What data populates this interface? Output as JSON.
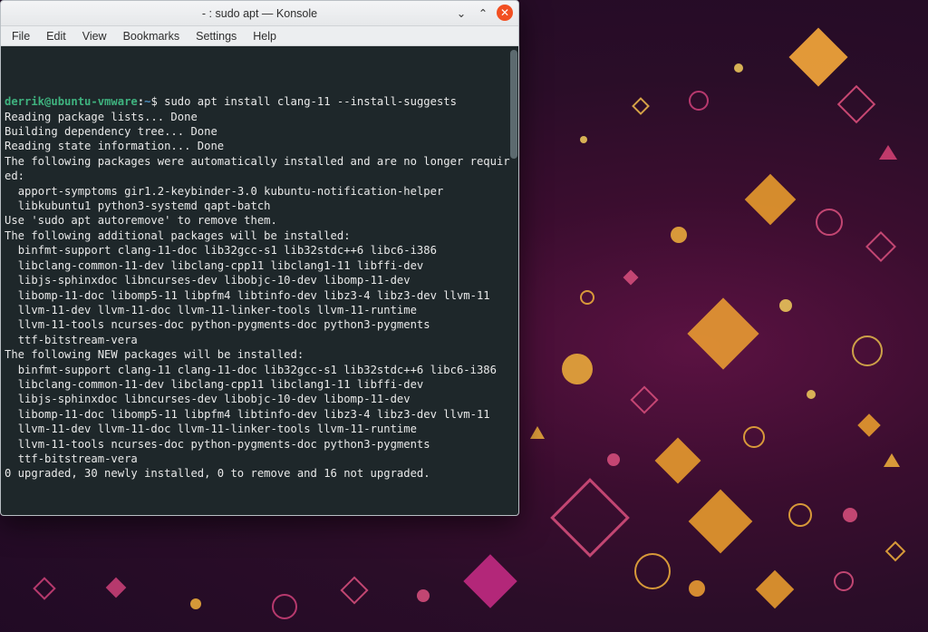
{
  "window": {
    "title": "- : sudo apt — Konsole"
  },
  "menubar": {
    "items": [
      "File",
      "Edit",
      "View",
      "Bookmarks",
      "Settings",
      "Help"
    ]
  },
  "prompt": {
    "user_host": "derrik@ubuntu-vmware",
    "separator": ":",
    "path": "~",
    "symbol": "$",
    "command": "sudo apt install clang-11 --install-suggests"
  },
  "terminal_lines": [
    "Reading package lists... Done",
    "Building dependency tree... Done",
    "Reading state information... Done",
    "The following packages were automatically installed and are no longer requir",
    "ed:",
    "  apport-symptoms gir1.2-keybinder-3.0 kubuntu-notification-helper",
    "  libkubuntu1 python3-systemd qapt-batch",
    "Use 'sudo apt autoremove' to remove them.",
    "The following additional packages will be installed:",
    "  binfmt-support clang-11-doc lib32gcc-s1 lib32stdc++6 libc6-i386",
    "  libclang-common-11-dev libclang-cpp11 libclang1-11 libffi-dev",
    "  libjs-sphinxdoc libncurses-dev libobjc-10-dev libomp-11-dev",
    "  libomp-11-doc libomp5-11 libpfm4 libtinfo-dev libz3-4 libz3-dev llvm-11",
    "  llvm-11-dev llvm-11-doc llvm-11-linker-tools llvm-11-runtime",
    "  llvm-11-tools ncurses-doc python-pygments-doc python3-pygments",
    "  ttf-bitstream-vera",
    "The following NEW packages will be installed:",
    "  binfmt-support clang-11 clang-11-doc lib32gcc-s1 lib32stdc++6 libc6-i386",
    "  libclang-common-11-dev libclang-cpp11 libclang1-11 libffi-dev",
    "  libjs-sphinxdoc libncurses-dev libobjc-10-dev libomp-11-dev",
    "  libomp-11-doc libomp5-11 libpfm4 libtinfo-dev libz3-4 libz3-dev llvm-11",
    "  llvm-11-dev llvm-11-doc llvm-11-linker-tools llvm-11-runtime",
    "  llvm-11-tools ncurses-doc python-pygments-doc python3-pygments",
    "  ttf-bitstream-vera",
    "0 upgraded, 30 newly installed, 0 to remove and 16 not upgraded."
  ],
  "icons": {
    "minimize": "⌄",
    "maximize": "⌃",
    "close": "✕"
  }
}
